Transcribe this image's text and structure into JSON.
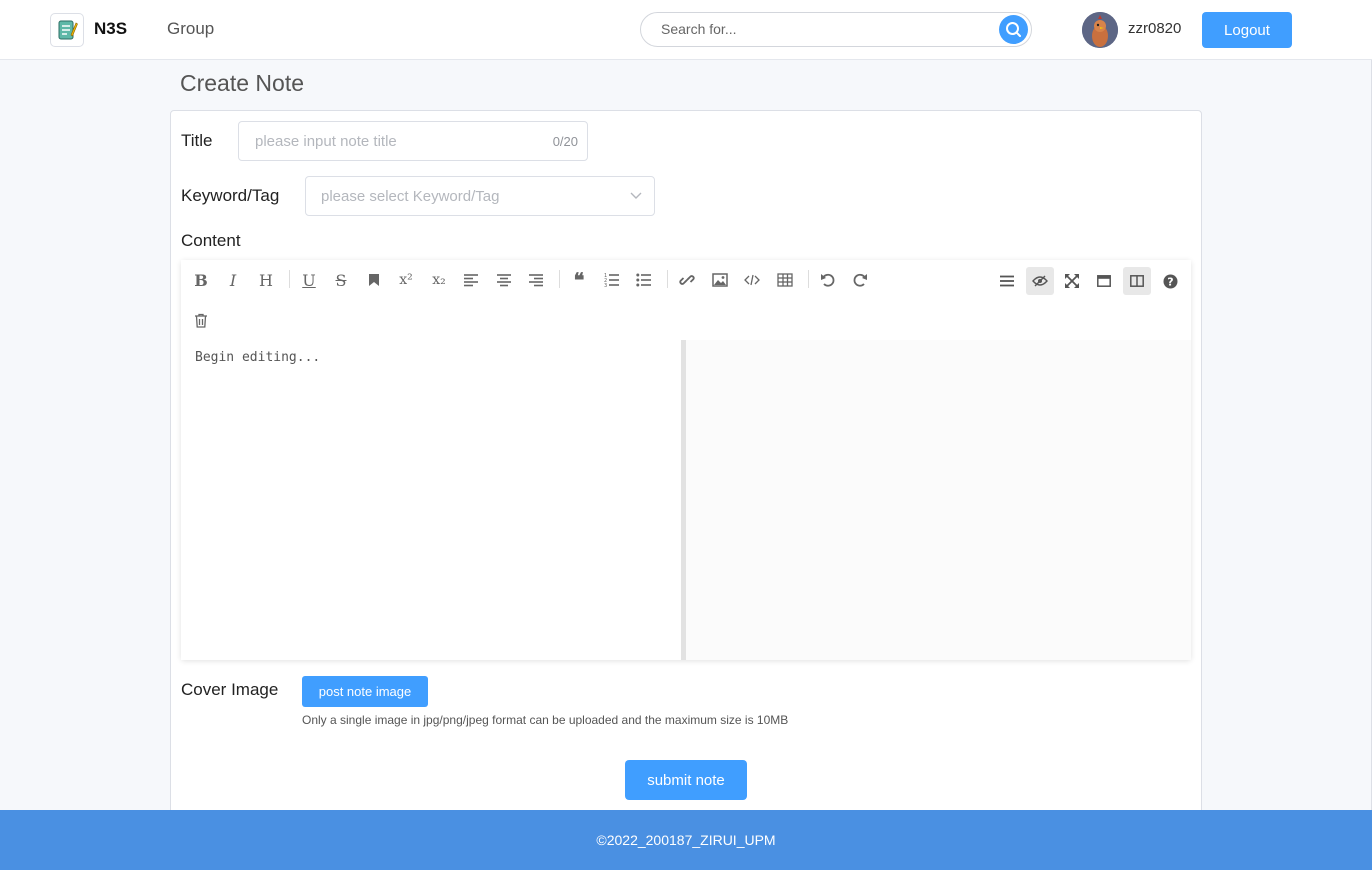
{
  "header": {
    "brand": "N3S",
    "nav_group": "Group",
    "search_placeholder": "Search for...",
    "username": "zzr0820",
    "logout_label": "Logout"
  },
  "page": {
    "title": "Create Note"
  },
  "form": {
    "title_label": "Title",
    "title_placeholder": "please input note title",
    "title_counter": "0/20",
    "tag_label": "Keyword/Tag",
    "tag_placeholder": "please select Keyword/Tag",
    "content_label": "Content",
    "editor_placeholder": "Begin editing...",
    "cover_label": "Cover Image",
    "post_image_label": "post note image",
    "cover_hint": "Only a single image in jpg/png/jpeg format can be uploaded and the maximum size is 10MB",
    "submit_label": "submit note"
  },
  "toolbar": {
    "left_icons": [
      "bold-icon",
      "italic-icon",
      "heading-icon",
      "underline-icon",
      "strikethrough-icon",
      "bookmark-icon",
      "superscript-icon",
      "subscript-icon",
      "align-left-icon",
      "align-center-icon",
      "align-right-icon",
      "quote-icon",
      "ordered-list-icon",
      "unordered-list-icon",
      "link-icon",
      "image-icon",
      "code-icon",
      "table-icon",
      "undo-icon",
      "redo-icon",
      "trash-icon"
    ],
    "right_icons": [
      "navigation-icon",
      "preview-toggle-icon",
      "fullscreen-icon",
      "window-icon",
      "split-view-icon",
      "help-icon"
    ]
  },
  "footer": {
    "copyright": "©2022_200187_ZIRUI_UPM"
  },
  "colors": {
    "primary": "#409eff",
    "footer": "#4a90e2"
  }
}
